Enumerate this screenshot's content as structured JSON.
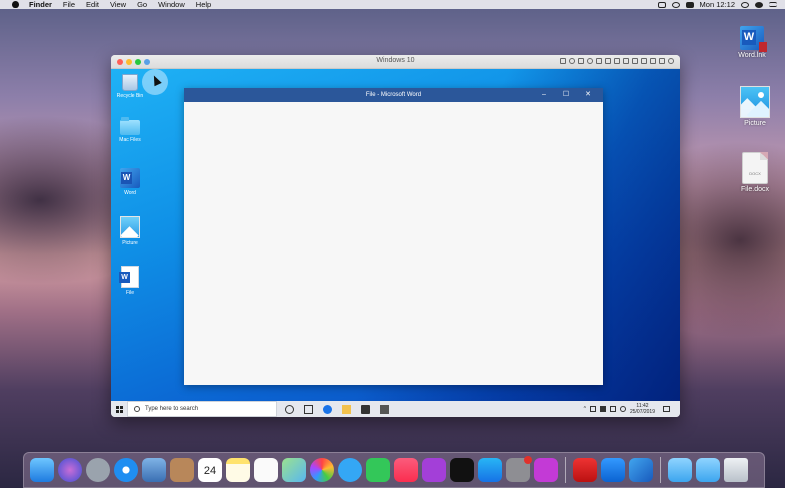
{
  "menubar": {
    "app_name": "Finder",
    "items": [
      "File",
      "Edit",
      "View",
      "Go",
      "Window",
      "Help"
    ],
    "clock": "Mon 12:12"
  },
  "desktop_icons": {
    "word_lnk": "Word.lnk",
    "picture": "Picture",
    "file_docx": "File.docx",
    "file_docx_ext": "DOCX"
  },
  "vm": {
    "title": "Windows 10",
    "desktop_icons": {
      "recycle_bin": "Recycle Bin",
      "mac_files": "Mac Files",
      "word": "Word",
      "picture": "Picture",
      "file": "File"
    },
    "word_window": {
      "title": "File - Microsoft Word",
      "minimize": "–",
      "maximize": "☐",
      "close": "✕"
    },
    "taskbar": {
      "search_placeholder": "Type here to search",
      "time": "11:42",
      "date": "25/07/2019"
    }
  },
  "dock": {
    "calendar_day": "24"
  },
  "colors": {
    "word_blue": "#2b579a",
    "win_blue": "#0f8fe6",
    "traffic_red": "#fe5f57",
    "traffic_yellow": "#febc2e",
    "traffic_green": "#28c840"
  }
}
